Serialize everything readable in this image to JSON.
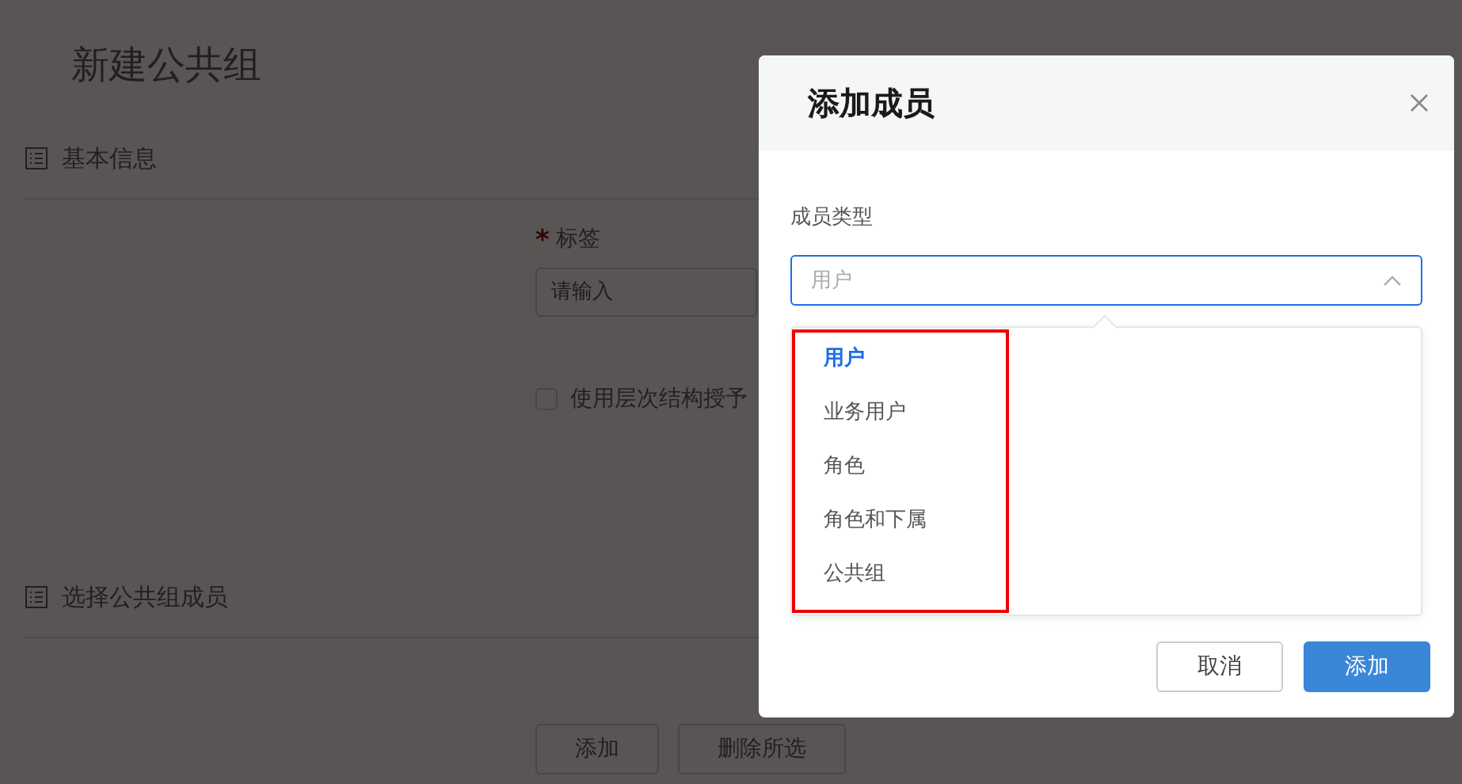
{
  "page": {
    "title": "新建公共组",
    "sections": [
      {
        "title": "基本信息"
      },
      {
        "title": "选择公共组成员"
      }
    ],
    "label_field": {
      "label": "标签",
      "required": true,
      "required_mark": "*",
      "placeholder": "请输入"
    },
    "hierarchy_checkbox": {
      "label": "使用层次结构授予",
      "checked": false
    },
    "member_buttons": [
      "添加",
      "删除所选"
    ]
  },
  "dialog": {
    "title": "添加成员",
    "field_label": "成员类型",
    "select": {
      "value": "用户",
      "expanded": true
    },
    "options": [
      {
        "label": "用户",
        "selected": true
      },
      {
        "label": "业务用户",
        "selected": false
      },
      {
        "label": "角色",
        "selected": false
      },
      {
        "label": "角色和下属",
        "selected": false
      },
      {
        "label": "公共组",
        "selected": false
      }
    ],
    "buttons": [
      {
        "label": "取消",
        "kind": "secondary"
      },
      {
        "label": "添加",
        "kind": "primary"
      }
    ]
  }
}
